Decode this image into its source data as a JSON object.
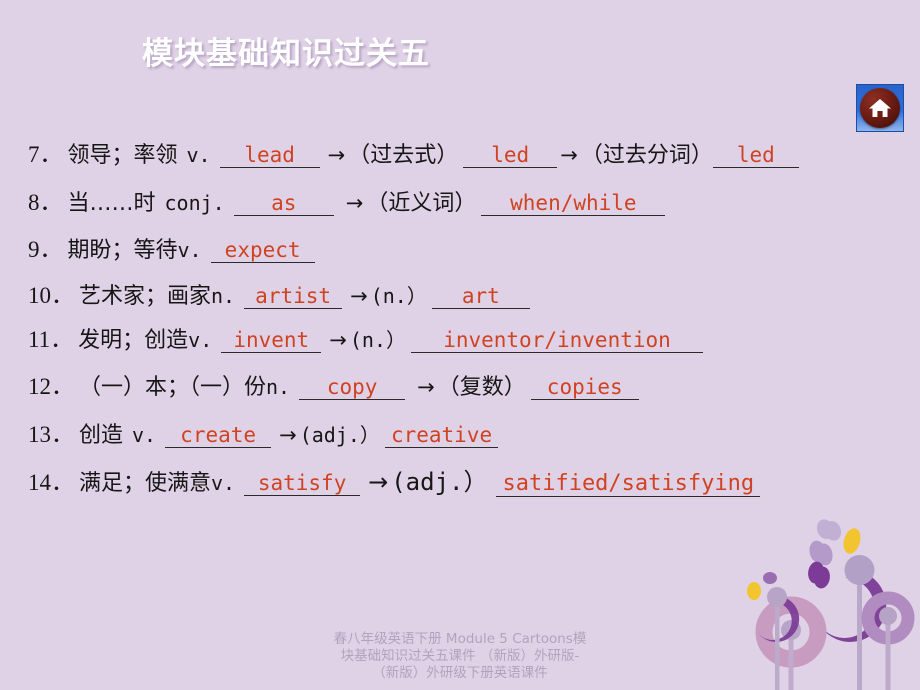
{
  "slide": {
    "title": "模块基础知识过关五",
    "background_color": "#e0d2e6",
    "title_color": "#ffffff",
    "answer_color": "#cf4322",
    "text_color": "#161616"
  },
  "home_button": {
    "icon": "home-icon",
    "label": "",
    "circle_color": "#6e1d14",
    "plate_color": "#2f6fdc"
  },
  "items": [
    {
      "number": "7．",
      "chinese": "领导；率领",
      "pos": "v.",
      "answer1": "lead",
      "arrow1": "→",
      "label2": "（过去式）",
      "answer2": "led",
      "arrow2": "→",
      "label3": "（过去分词）",
      "answer3": "led"
    },
    {
      "number": "8．",
      "chinese": "当……时",
      "pos": "conj.",
      "answer1": "as",
      "arrow1": "→",
      "label2": "（近义词）",
      "answer2": "when/while"
    },
    {
      "number": "9．",
      "chinese": "期盼；等待",
      "pos": "v.",
      "answer1": "expect"
    },
    {
      "number": "10．",
      "chinese": "艺术家；画家",
      "pos": "n.",
      "answer1": "artist",
      "arrow1": "→",
      "label2": "(n.）",
      "answer2": "art"
    },
    {
      "number": "11．",
      "chinese": "发明；创造",
      "pos": "v.",
      "answer1": "invent",
      "arrow1": "→",
      "label2": "(n.）",
      "answer2": "inventor/invention"
    },
    {
      "number": "12．",
      "chinese": "（一）本；（一）份",
      "pos": "n.",
      "answer1": "copy",
      "arrow1": "→",
      "label2": "（复数）",
      "answer2": "copies"
    },
    {
      "number": "13．",
      "chinese": "创造",
      "pos": "v.",
      "answer1": "create",
      "arrow1": "→",
      "label2": "(adj.）",
      "answer2": "creative"
    },
    {
      "number": "14．",
      "chinese": "满足；使满意",
      "pos": "v.",
      "answer1": "satisfy",
      "arrow1": "→",
      "label2": "(adj.）",
      "answer2": "satified/satisfying"
    }
  ],
  "footer": {
    "line1": "春八年级英语下册 Module 5 Cartoons模",
    "line2": "块基础知识过关五课件 （新版）外研版-",
    "line3": "（新版）外研级下册英语课件"
  }
}
